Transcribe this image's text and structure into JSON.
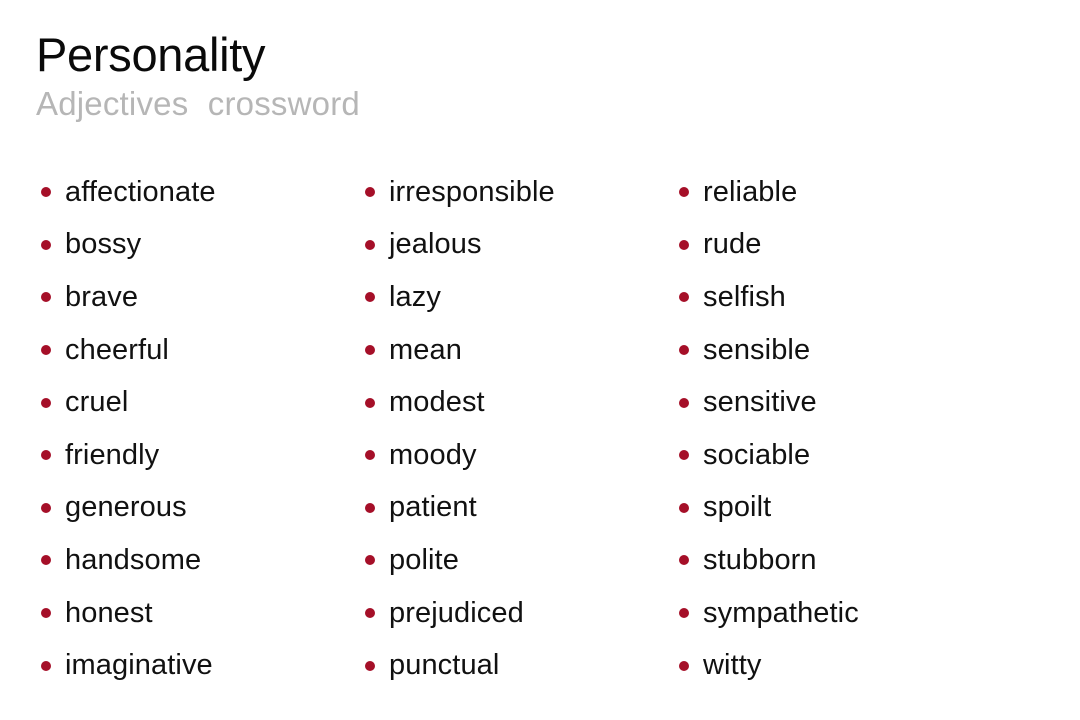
{
  "header": {
    "title": "Personality",
    "subtitle": "Adjectives crossword"
  },
  "colors": {
    "bullet": "#a50f28",
    "title": "#0a0a0a",
    "subtitle": "#b6b6b6",
    "word": "#111111",
    "background": "#ffffff"
  },
  "icons": {
    "bullet": "bullet-dot-icon"
  },
  "columns": [
    {
      "items": [
        "affectionate",
        "bossy",
        "brave",
        "cheerful",
        "cruel",
        "friendly",
        "generous",
        "handsome",
        "honest",
        "imaginative"
      ]
    },
    {
      "items": [
        "irresponsible",
        "jealous",
        "lazy",
        "mean",
        "modest",
        "moody",
        "patient",
        "polite",
        "prejudiced",
        "punctual"
      ]
    },
    {
      "items": [
        "reliable",
        "rude",
        "selfish",
        "sensible",
        "sensitive",
        "sociable",
        "spoilt",
        "stubborn",
        "sympathetic",
        "witty"
      ]
    }
  ]
}
